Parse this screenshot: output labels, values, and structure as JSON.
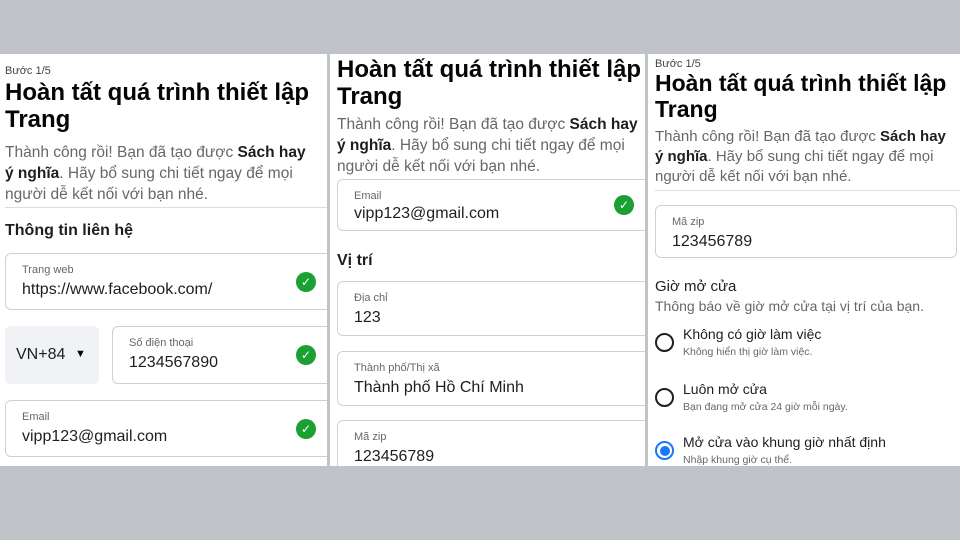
{
  "common": {
    "step": "Bước 1/5",
    "title_line1": "Hoàn tất quá trình thiết lập",
    "title_line2": "Trang",
    "desc_part1": "Thành công rồi! Bạn đã tạo được ",
    "desc_bold1": "Sách hay",
    "desc_bold2": "ý nghĩa",
    "desc_part2": ". Hãy bổ sung chi tiết ngay để mọi",
    "desc_line3": "người dễ kết nối với bạn nhé."
  },
  "panel1": {
    "section": "Thông tin liên hệ",
    "website": {
      "label": "Trang web",
      "value": "https://www.facebook.com/"
    },
    "country_code": "VN+84",
    "phone": {
      "label": "Số điện thoại",
      "value": "1234567890"
    },
    "email": {
      "label": "Email",
      "value": "vipp123@gmail.com"
    }
  },
  "panel2": {
    "email": {
      "label": "Email",
      "value": "vipp123@gmail.com"
    },
    "section": "Vị trí",
    "address": {
      "label": "Địa chỉ",
      "value": "123"
    },
    "city": {
      "label": "Thành phố/Thị xã",
      "value": "Thành phố Hồ Chí Minh"
    },
    "zip": {
      "label": "Mã zip",
      "value": "123456789"
    }
  },
  "panel3": {
    "zip": {
      "label": "Mã zip",
      "value": "123456789"
    },
    "section": "Giờ mở cửa",
    "section_sub": "Thông báo về giờ mở cửa tại vị trí của bạn.",
    "options": [
      {
        "title": "Không có giờ làm việc",
        "sub": "Không hiển thị giờ làm việc.",
        "selected": false
      },
      {
        "title": "Luôn mở cửa",
        "sub": "Bạn đang mở cửa 24 giờ mỗi ngày.",
        "selected": false
      },
      {
        "title": "Mở cửa vào khung giờ nhất định",
        "sub": "Nhập khung giờ cụ thể.",
        "selected": true
      }
    ]
  },
  "colors": {
    "check": "#1aa033",
    "radio_selected": "#1877f2",
    "background": "#c0c3c7"
  },
  "icons": {
    "check": "check-circle-icon",
    "dropdown": "caret-down-icon"
  }
}
